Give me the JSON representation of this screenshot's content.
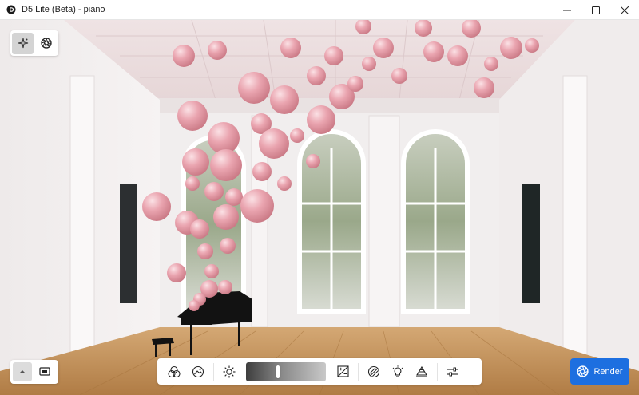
{
  "window": {
    "title": "D5 Lite (Beta) - piano",
    "controls": {
      "minimize": "minimize-icon",
      "maximize": "maximize-icon",
      "close": "close-icon"
    }
  },
  "mode_switch": {
    "items": [
      {
        "icon": "sparkle-icon",
        "active": true
      },
      {
        "icon": "aperture-icon",
        "active": false
      }
    ]
  },
  "bottom_left": {
    "items": [
      {
        "icon": "collapse-up-icon"
      },
      {
        "icon": "screen-capture-icon"
      }
    ]
  },
  "toolbar": {
    "items": [
      "color-circles-icon",
      "image-adjust-icon",
      "sun-icon",
      "exposure-slider",
      "exposure-compensation-icon",
      "hatch-icon",
      "bulb-icon",
      "layers-icon",
      "sliders-icon"
    ],
    "exposure_level": 0.4
  },
  "render": {
    "label": "Render",
    "icon": "aperture-icon"
  },
  "colors": {
    "accent": "#1d6fe0",
    "balloon": "#e8a2ad",
    "floor": "#c6945d"
  }
}
